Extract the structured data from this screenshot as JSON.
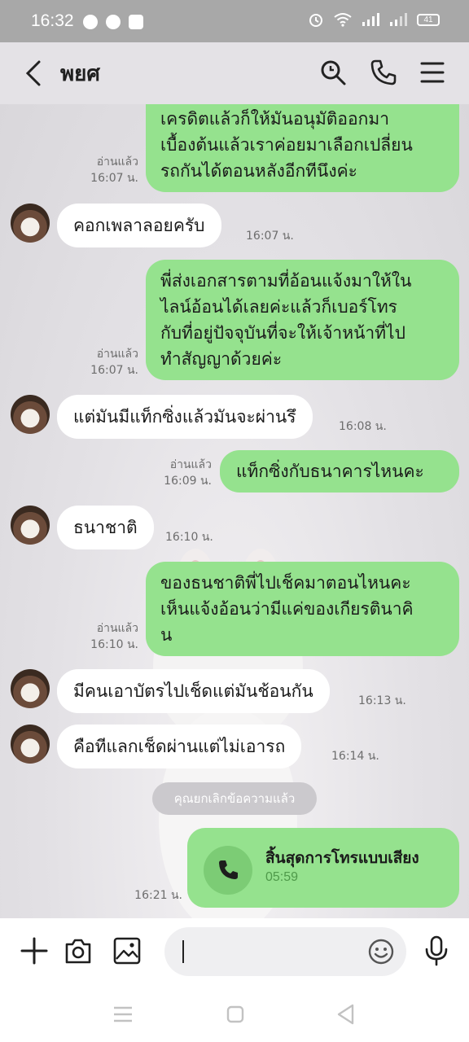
{
  "status_bar": {
    "time": "16:32",
    "battery": "41"
  },
  "header": {
    "title": "พยศ"
  },
  "messages": [
    {
      "from": "me",
      "text": "เครดิตแล้วก็ให้มันอนุมัติออกมา\nเบื้องต้นแล้วเราค่อยมาเลือกเปลี่ยน\nรถกันได้ตอนหลังอีกทีนึงค่ะ",
      "read": "อ่านแล้ว",
      "time": "16:07 น."
    },
    {
      "from": "them",
      "text": "คอกเพลาลอยครับ",
      "time": "16:07 น."
    },
    {
      "from": "me",
      "text": "พี่ส่งเอกสารตามที่อ้อนแจ้งมาให้ใน\nไลน์อ้อนได้เลยค่ะแล้วก็เบอร์โทร\nกับที่อยู่ปัจจุบันที่จะให้เจ้าหน้าที่ไป\nทำสัญญาด้วยค่ะ",
      "read": "อ่านแล้ว",
      "time": "16:07 น."
    },
    {
      "from": "them",
      "text": "แต่มันมีแท็กซิ่งแล้วมันจะผ่านรึ",
      "time": "16:08 น."
    },
    {
      "from": "me",
      "text": "แท็กซิ่งกับธนาคารไหนคะ",
      "read": "อ่านแล้ว",
      "time": "16:09 น."
    },
    {
      "from": "them",
      "text": "ธนาชาติ",
      "time": "16:10 น."
    },
    {
      "from": "me",
      "text": "ของธนชาติพี่ไปเช็คมาตอนไหนคะ\nเห็นแจ้งอ้อนว่ามีแค่ของเกียรตินาคิ\nน",
      "read": "อ่านแล้ว",
      "time": "16:10 น."
    },
    {
      "from": "them",
      "text": "มีคนเอาบัตรไปเช็ดแต่มันช้อนกัน",
      "time": "16:13 น."
    },
    {
      "from": "them",
      "text": "คือทีแลกเช็ดผ่านแต่ไม่เอารถ",
      "time": "16:14 น."
    }
  ],
  "notice": "คุณยกเลิกข้อความแล้ว",
  "call": {
    "title": "สิ้นสุดการโทรแบบเสียง",
    "duration": "05:59",
    "time": "16:21 น."
  },
  "input": {
    "value": ""
  }
}
